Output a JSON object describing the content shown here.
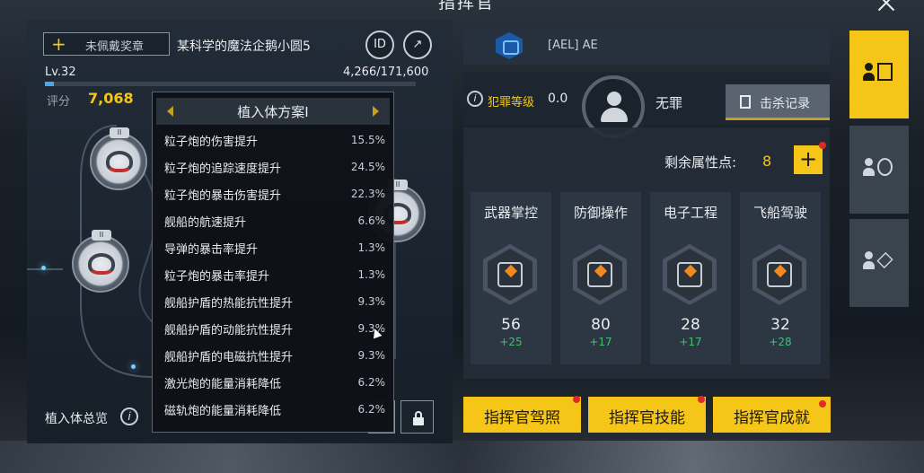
{
  "header": {
    "title": "指挥官"
  },
  "profile": {
    "award_button": "未佩戴奖章",
    "award_plus": "+",
    "name": "某科学的魔法企鹅小圆5",
    "id_button": "ID",
    "share_button": "↗",
    "level": "Lv.32",
    "exp": "4,266/171,600",
    "exp_progress": 0.025,
    "score_label": "评分",
    "score_value": "7,068"
  },
  "implant_popup": {
    "title": "植入体方案I",
    "rows": [
      {
        "name": "粒子炮的伤害提升",
        "value": "15.5%"
      },
      {
        "name": "粒子炮的追踪速度提升",
        "value": "24.5%"
      },
      {
        "name": "粒子炮的暴击伤害提升",
        "value": "22.3%"
      },
      {
        "name": "舰船的航速提升",
        "value": "6.6%"
      },
      {
        "name": "导弹的暴击率提升",
        "value": "1.3%"
      },
      {
        "name": "粒子炮的暴击率提升",
        "value": "1.3%"
      },
      {
        "name": "舰船护盾的热能抗性提升",
        "value": "9.3%"
      },
      {
        "name": "舰船护盾的动能抗性提升",
        "value": "9.3%"
      },
      {
        "name": "舰船护盾的电磁抗性提升",
        "value": "9.3%"
      },
      {
        "name": "激光炮的能量消耗降低",
        "value": "6.2%"
      },
      {
        "name": "磁轨炮的能量消耗降低",
        "value": "6.2%"
      }
    ]
  },
  "implants": {
    "overview_label": "植入体总览",
    "info": "i",
    "ranks": [
      "II",
      "II",
      "II"
    ]
  },
  "org": {
    "name": "[AEL] AE"
  },
  "crime": {
    "label": "犯罪等级",
    "value": "0.0",
    "status": "无罪",
    "kill_record": "击杀记录",
    "info": "i"
  },
  "attributes": {
    "remaining_label": "剩余属性点:",
    "remaining_value": "8",
    "plus": "+",
    "items": [
      {
        "name": "武器掌控",
        "value": "56",
        "bonus": "+25"
      },
      {
        "name": "防御操作",
        "value": "80",
        "bonus": "+17"
      },
      {
        "name": "电子工程",
        "value": "28",
        "bonus": "+17"
      },
      {
        "name": "飞船驾驶",
        "value": "32",
        "bonus": "+28"
      }
    ]
  },
  "bottom_buttons": [
    "指挥官驾照",
    "指挥官技能",
    "指挥官成就"
  ],
  "colors": {
    "accent": "#f5c518",
    "bonus": "#3ec070",
    "notify": "#e02a2a"
  }
}
